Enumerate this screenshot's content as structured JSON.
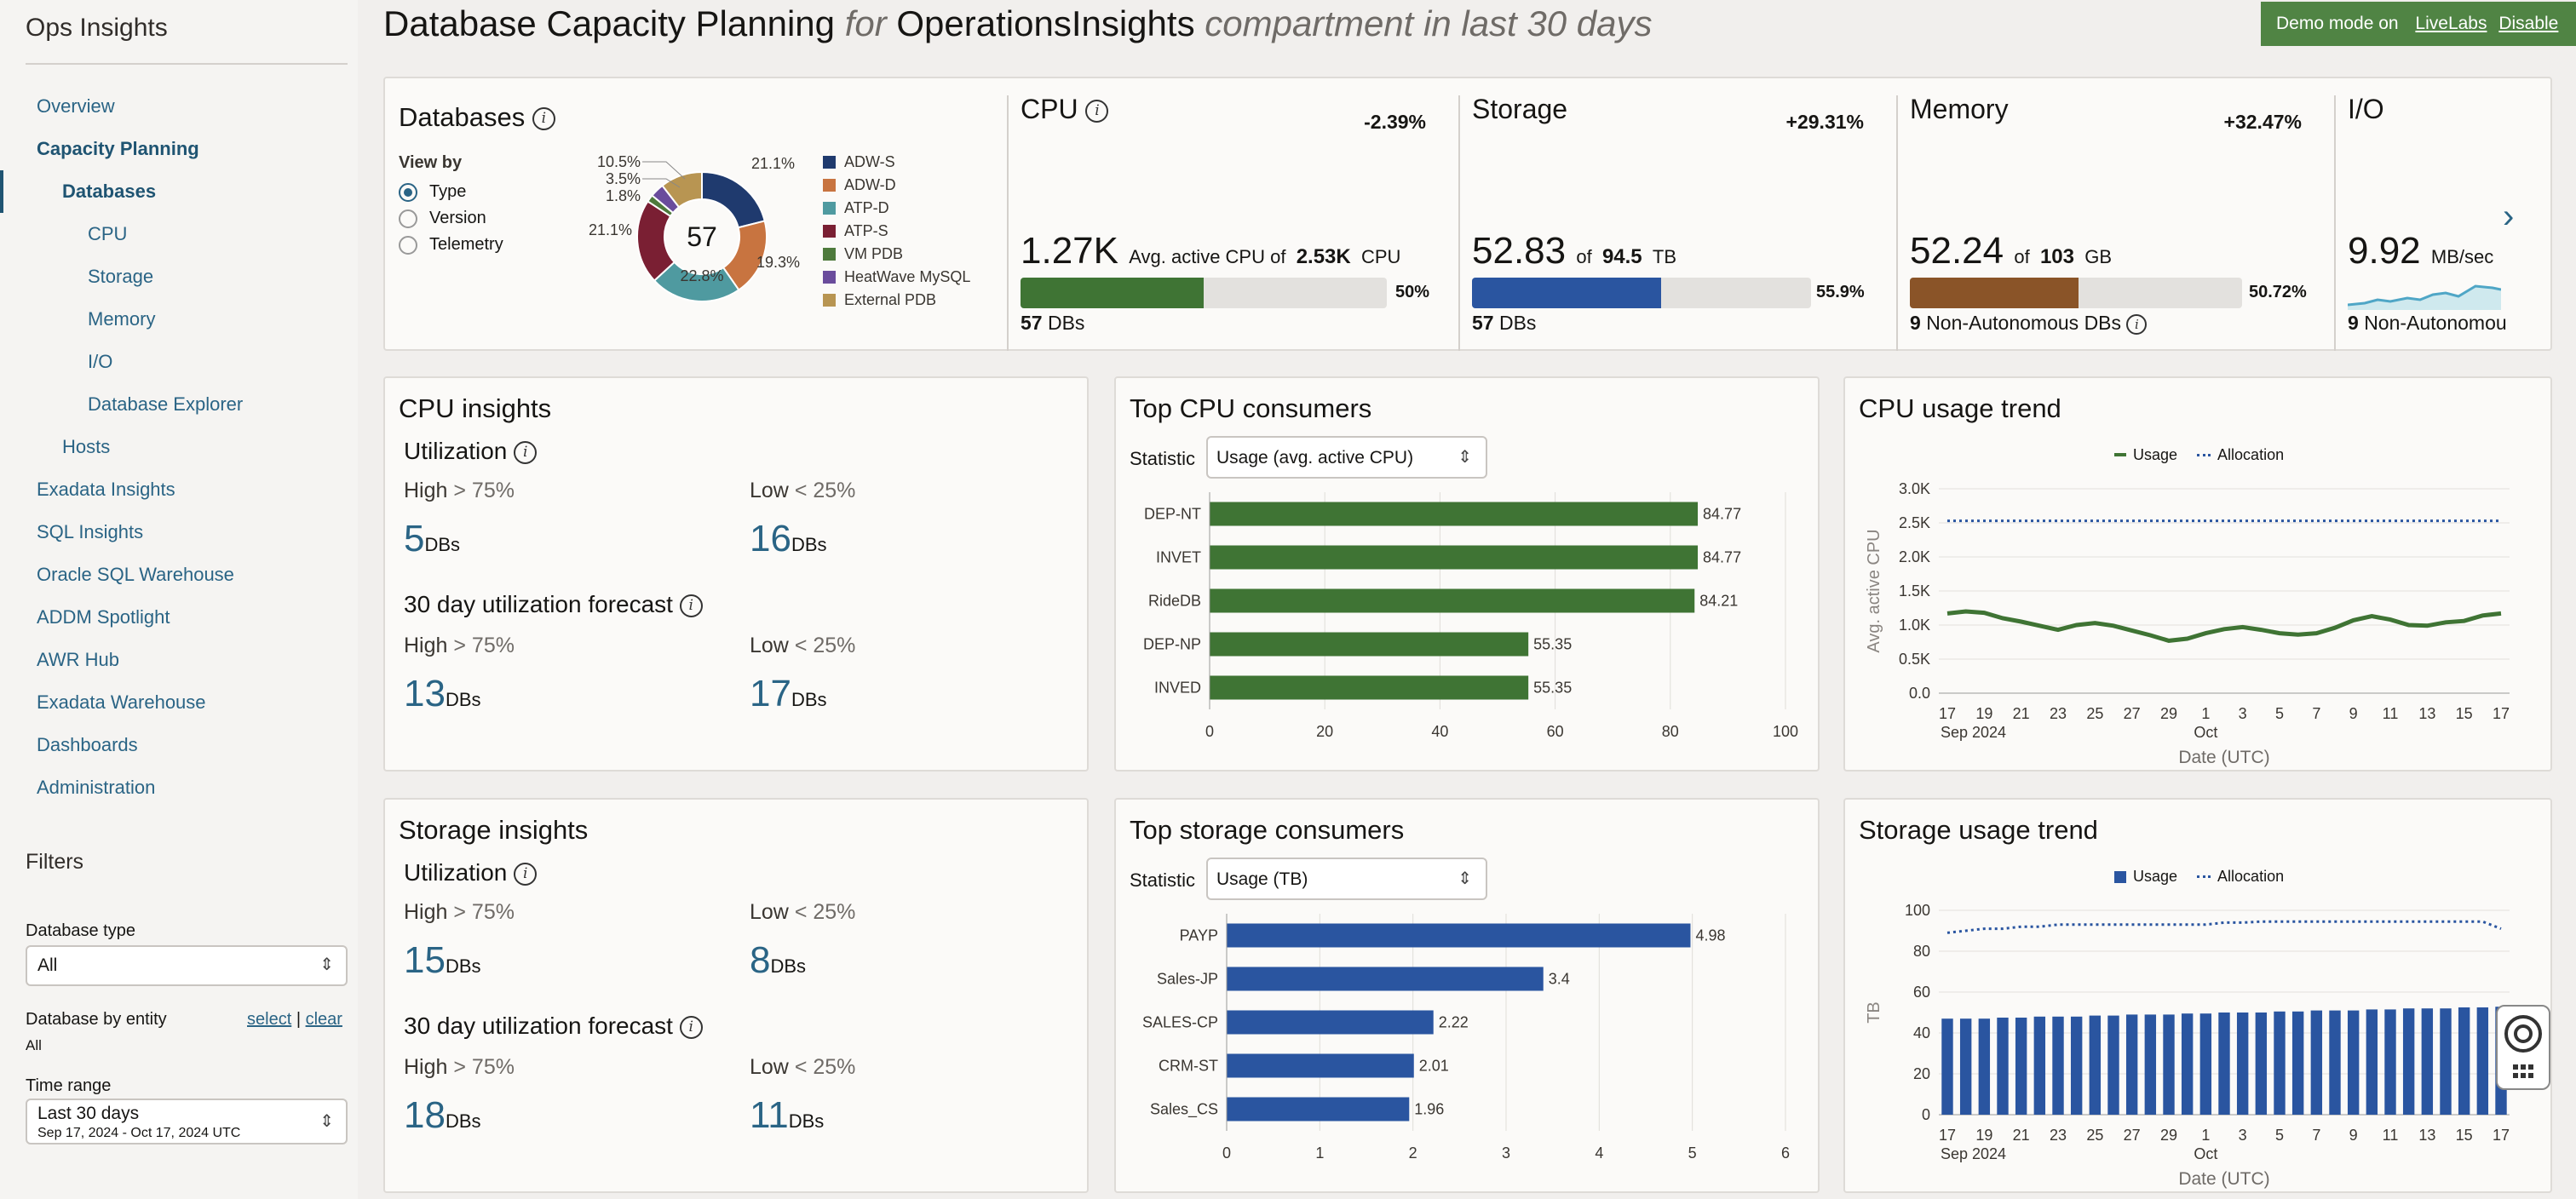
{
  "sidebar": {
    "app_title": "Ops Insights",
    "nav": [
      {
        "label": "Overview"
      },
      {
        "label": "Capacity Planning"
      },
      {
        "label": "Databases"
      },
      {
        "label": "CPU"
      },
      {
        "label": "Storage"
      },
      {
        "label": "Memory"
      },
      {
        "label": "I/O"
      },
      {
        "label": "Database Explorer"
      },
      {
        "label": "Hosts"
      },
      {
        "label": "Exadata Insights"
      },
      {
        "label": "SQL Insights"
      },
      {
        "label": "Oracle SQL Warehouse"
      },
      {
        "label": "ADDM Spotlight"
      },
      {
        "label": "AWR Hub"
      },
      {
        "label": "Exadata Warehouse"
      },
      {
        "label": "Dashboards"
      },
      {
        "label": "Administration"
      }
    ],
    "filters": {
      "title": "Filters",
      "db_type_label": "Database type",
      "db_type_value": "All",
      "entity_label": "Database by entity",
      "entity_select": "select",
      "entity_sep": "|",
      "entity_clear": "clear",
      "entity_value": "All",
      "time_label": "Time range",
      "time_value": "Last 30 days",
      "time_sub": "Sep 17, 2024 - Oct 17, 2024 UTC"
    }
  },
  "header": {
    "title_main": "Database Capacity Planning",
    "title_for": "for",
    "compartment": "OperationsInsights",
    "title_suffix": "compartment in last 30 days"
  },
  "demo_banner": {
    "text": "Demo mode on",
    "livelabs": "LiveLabs",
    "disable": "Disable"
  },
  "summary": {
    "databases_title": "Databases",
    "view_by_label": "View by",
    "view_by_options": [
      "Type",
      "Version",
      "Telemetry"
    ],
    "view_by_selected": "Type",
    "donut_total": "57",
    "donut_labels": [
      "21.1%",
      "19.3%",
      "22.8%",
      "21.1%",
      "1.8%",
      "3.5%",
      "10.5%"
    ],
    "legend": [
      "ADW-S",
      "ADW-D",
      "ATP-D",
      "ATP-S",
      "VM PDB",
      "HeatWave MySQL",
      "External PDB"
    ],
    "cpu": {
      "title": "CPU",
      "change": "-2.39%",
      "value": "1.27K",
      "of_text": "Avg. active CPU of",
      "total": "2.53K",
      "unit": "CPU",
      "pct": "50%",
      "pct_num": 50,
      "count": "57",
      "count_label": "DBs"
    },
    "storage": {
      "title": "Storage",
      "change": "+29.31%",
      "value": "52.83",
      "of_text": "of",
      "total": "94.5",
      "unit": "TB",
      "pct": "55.9%",
      "pct_num": 55.9,
      "count": "57",
      "count_label": "DBs"
    },
    "memory": {
      "title": "Memory",
      "change": "+32.47%",
      "value": "52.24",
      "of_text": "of",
      "total": "103",
      "unit": "GB",
      "pct": "50.72%",
      "pct_num": 50.72,
      "count": "9",
      "count_label": "Non-Autonomous DBs"
    },
    "io": {
      "title": "I/O",
      "value": "9.92",
      "unit": "MB/sec",
      "count": "9",
      "count_label": "Non-Autonomou"
    }
  },
  "cpu_insights": {
    "title": "CPU insights",
    "util_title": "Utilization",
    "high_label": "High",
    "high_thr": "> 75%",
    "low_label": "Low",
    "low_thr": "< 25%",
    "util_high": "5",
    "util_low": "16",
    "forecast_title": "30 day utilization forecast",
    "fc_high": "13",
    "fc_low": "17",
    "dbs": "DBs"
  },
  "storage_insights": {
    "title": "Storage insights",
    "util_title": "Utilization",
    "high_label": "High",
    "high_thr": "> 75%",
    "low_label": "Low",
    "low_thr": "< 25%",
    "util_high": "15",
    "util_low": "8",
    "forecast_title": "30 day utilization forecast",
    "fc_high": "18",
    "fc_low": "11",
    "dbs": "DBs"
  },
  "top_cpu": {
    "title": "Top CPU consumers",
    "stat_label": "Statistic",
    "stat_value": "Usage (avg. active CPU)"
  },
  "top_storage": {
    "title": "Top storage consumers",
    "stat_label": "Statistic",
    "stat_value": "Usage (TB)"
  },
  "cpu_trend": {
    "title": "CPU usage trend",
    "legend_usage": "Usage",
    "legend_alloc": "Allocation"
  },
  "storage_trend": {
    "title": "Storage usage trend",
    "legend_usage": "Usage",
    "legend_alloc": "Allocation"
  },
  "colors": {
    "adw_s": "#1f3a6e",
    "adw_d": "#c87440",
    "atp_d": "#4f9aa0",
    "atp_s": "#7a1f33",
    "vm_pdb": "#4e7a3c",
    "heatwave": "#6a4c9c",
    "external": "#b89552",
    "cpu_green": "#3f7434",
    "storage_blue": "#2a55a0",
    "memory_brown": "#8a5428",
    "link": "#2a6485"
  },
  "chart_data": [
    {
      "type": "pie",
      "title": "Databases",
      "categories": [
        "ADW-S",
        "ADW-D",
        "ATP-D",
        "ATP-S",
        "VM PDB",
        "HeatWave MySQL",
        "External PDB"
      ],
      "values": [
        21.1,
        19.3,
        22.8,
        21.1,
        1.8,
        3.5,
        10.5
      ],
      "total": 57
    },
    {
      "type": "bar",
      "title": "Top CPU consumers",
      "categories": [
        "DEP-NT",
        "INVET",
        "RideDB",
        "DEP-NP",
        "INVED"
      ],
      "values": [
        84.77,
        84.77,
        84.21,
        55.35,
        55.35
      ],
      "xlim": [
        0,
        100
      ],
      "ticks": [
        0,
        20,
        40,
        60,
        80,
        100
      ]
    },
    {
      "type": "bar",
      "title": "Top storage consumers",
      "categories": [
        "PAYP",
        "Sales-JP",
        "SALES-CP",
        "CRM-ST",
        "Sales_CS"
      ],
      "values": [
        4.98,
        3.4,
        2.22,
        2.01,
        1.96
      ],
      "xlim": [
        0,
        6
      ],
      "ticks": [
        0,
        1,
        2,
        3,
        4,
        5,
        6
      ]
    },
    {
      "type": "line",
      "title": "CPU usage trend",
      "xlabel": "Date (UTC)",
      "ylabel": "Avg. active CPU",
      "x_ticks": [
        "17",
        "19",
        "21",
        "23",
        "25",
        "27",
        "29",
        "1",
        "3",
        "5",
        "7",
        "9",
        "11",
        "13",
        "15",
        "17"
      ],
      "x_sub": [
        "Sep 2024",
        "Oct"
      ],
      "y_ticks": [
        "0.0",
        "0.5K",
        "1.0K",
        "1.5K",
        "2.0K",
        "2.5K",
        "3.0K"
      ],
      "ylim": [
        0,
        3000
      ],
      "series": [
        {
          "name": "Usage",
          "values": [
            1170,
            1200,
            1180,
            1100,
            1050,
            990,
            930,
            1000,
            1030,
            990,
            920,
            850,
            770,
            800,
            880,
            940,
            970,
            930,
            880,
            860,
            880,
            960,
            1070,
            1130,
            1080,
            1000,
            990,
            1040,
            1060,
            1140,
            1170
          ]
        },
        {
          "name": "Allocation",
          "values": [
            2530,
            2530,
            2530,
            2530,
            2530,
            2530,
            2530,
            2530,
            2530,
            2530,
            2530,
            2530,
            2530,
            2530,
            2530,
            2530,
            2530,
            2530,
            2530,
            2530,
            2530,
            2530,
            2530,
            2530,
            2530,
            2530,
            2530,
            2530,
            2530,
            2530,
            2530
          ]
        }
      ]
    },
    {
      "type": "bar",
      "title": "Storage usage trend",
      "xlabel": "Date (UTC)",
      "ylabel": "TB",
      "x_ticks": [
        "17",
        "19",
        "21",
        "23",
        "25",
        "27",
        "29",
        "1",
        "3",
        "5",
        "7",
        "9",
        "11",
        "13",
        "15",
        "17"
      ],
      "x_sub": [
        "Sep 2024",
        "Oct"
      ],
      "y_ticks": [
        "0",
        "20",
        "40",
        "60",
        "80",
        "100"
      ],
      "ylim": [
        0,
        100
      ],
      "series": [
        {
          "name": "Usage",
          "values": [
            47,
            47,
            47,
            47.5,
            47.5,
            48,
            48,
            48,
            48.5,
            48.5,
            49,
            49,
            49,
            49.5,
            49.5,
            50,
            50,
            50,
            50.5,
            50.5,
            51,
            51,
            51,
            51.5,
            51.5,
            52,
            52,
            52,
            52.5,
            52.5,
            52.83
          ]
        },
        {
          "name": "Allocation",
          "values": [
            89,
            90,
            91,
            91,
            92,
            92,
            93,
            93,
            93,
            93,
            93,
            93,
            93,
            93,
            93,
            94,
            94,
            94.5,
            94.5,
            94.5,
            94.5,
            94.5,
            94.5,
            94.5,
            94.5,
            94.5,
            94.5,
            94.5,
            94.5,
            94.5,
            91
          ]
        }
      ]
    }
  ]
}
